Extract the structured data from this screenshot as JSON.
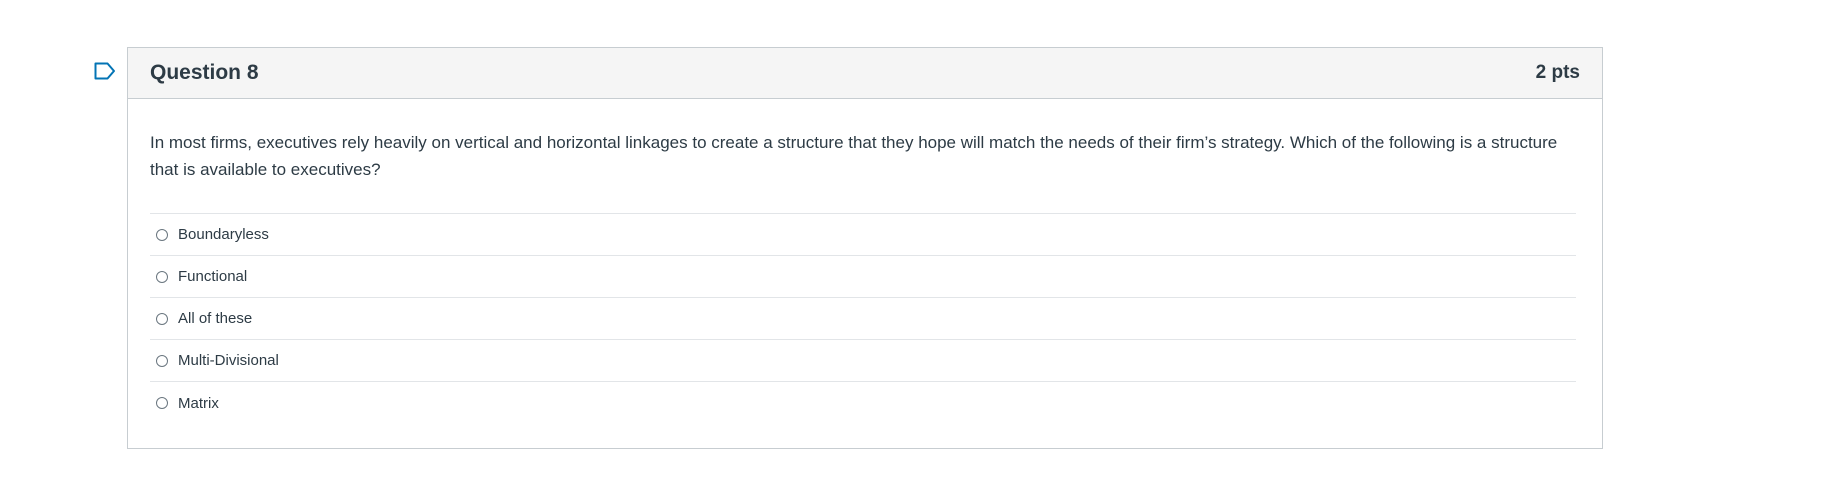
{
  "flag": {
    "icon": "flag-outline-icon",
    "color": "#0374b5"
  },
  "question": {
    "title": "Question 8",
    "points": "2 pts",
    "text": "In most firms, executives rely heavily on vertical and horizontal linkages to create a structure that they hope will match the needs of their firm’s strategy. Which of the following is a structure that is available to executives?",
    "answers": [
      {
        "label": "Boundaryless"
      },
      {
        "label": "Functional"
      },
      {
        "label": "All of these"
      },
      {
        "label": "Multi-Divisional"
      },
      {
        "label": "Matrix"
      }
    ]
  },
  "colors": {
    "text": "#2d3b45",
    "border": "#c7cdd1",
    "header_bg": "#f5f5f5",
    "divider": "#e2e5e8"
  }
}
